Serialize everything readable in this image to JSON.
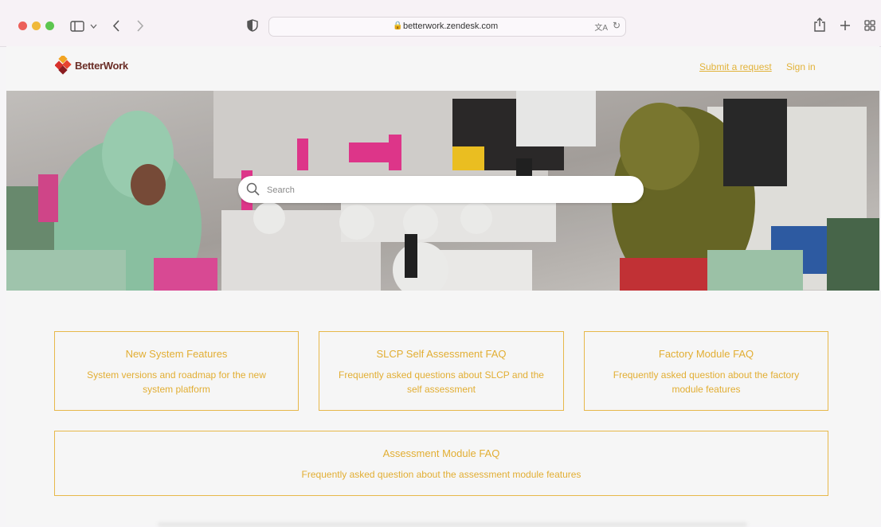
{
  "browser": {
    "url": "betterwork.zendesk.com",
    "lock_icon": "lock-icon",
    "nav_icons": [
      "sidebar-icon",
      "back-icon",
      "forward-icon",
      "shield-icon",
      "share-icon",
      "new-tab-icon",
      "tab-overview-icon"
    ]
  },
  "header": {
    "logo_text": "BetterWork",
    "submit_request": "Submit a request",
    "sign_in": "Sign in"
  },
  "hero": {
    "search_placeholder": "Search"
  },
  "colors": {
    "accent": "#e2ae33",
    "logo_text": "#6a2d26",
    "page_bg": "#f6f6f6"
  },
  "categories": [
    {
      "title": "New System Features",
      "description": "System versions and roadmap for the new system platform"
    },
    {
      "title": "SLCP Self Assessment FAQ",
      "description": "Frequently asked questions about SLCP and the self assessment"
    },
    {
      "title": "Factory Module FAQ",
      "description": "Frequently asked question about the factory module features"
    },
    {
      "title": "Assessment Module FAQ",
      "description": "Frequently asked question about the assessment module features"
    }
  ]
}
